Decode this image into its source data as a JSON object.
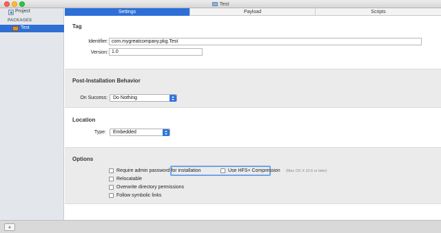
{
  "window": {
    "title": "Test"
  },
  "sidebar": {
    "project_label": "Project",
    "packages_heading": "PACKAGES",
    "package_label": "Test"
  },
  "bottom_bar": {
    "add_label": "+"
  },
  "tabs": [
    {
      "label": "Settings",
      "active": true
    },
    {
      "label": "Payload",
      "active": false
    },
    {
      "label": "Scripts",
      "active": false
    }
  ],
  "tag": {
    "title": "Tag",
    "identifier_label": "Identifier:",
    "identifier_value": "com.mygreatcompany.pkg.Test",
    "version_label": "Version:",
    "version_value": "1.0"
  },
  "post_install": {
    "title": "Post-Installation Behavior",
    "on_success_label": "On Success:",
    "on_success_value": "Do Nothing"
  },
  "location": {
    "title": "Location",
    "type_label": "Type:",
    "type_value": "Embedded"
  },
  "options": {
    "title": "Options",
    "require_admin": "Require admin password for installation",
    "relocatable": "Relocatable",
    "overwrite_permissions": "Overwrite directory permissions",
    "follow_symlinks": "Follow symbolic links",
    "hfs_compression": "Use HFS+ Compression",
    "hfs_note": "(Mac OS X 10.6 or later)"
  },
  "colors": {
    "accent": "#2d6fd8",
    "sidebar_bg": "#e3e7ec",
    "section_gray": "#ebebeb"
  }
}
